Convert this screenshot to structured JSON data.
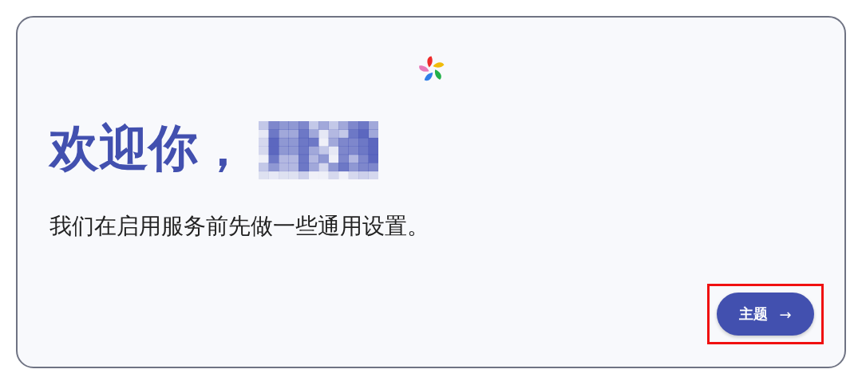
{
  "heading": "欢迎你，",
  "name_redacted": true,
  "message": "我们在启用服务前先做一些通用设置。",
  "next_button": {
    "label": "主题",
    "arrow": "→",
    "highlighted": true
  }
}
